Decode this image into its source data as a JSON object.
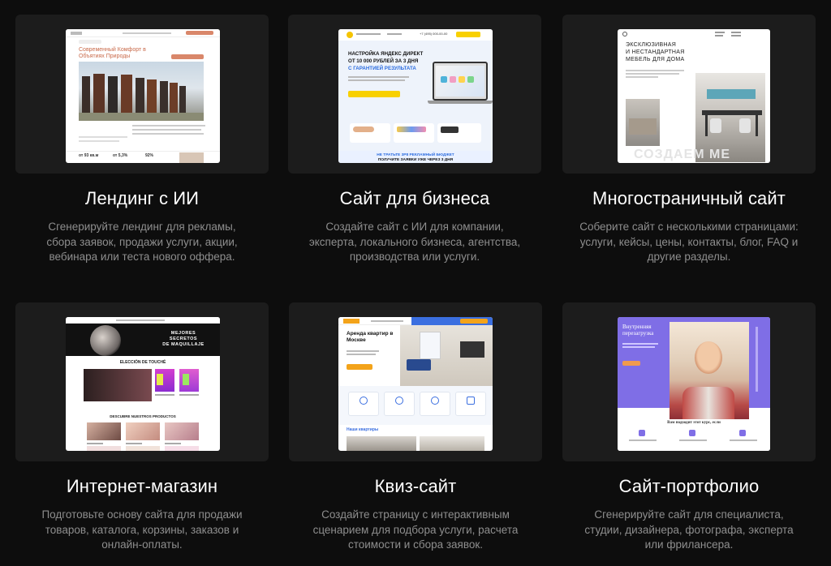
{
  "cards": [
    {
      "title": "Лендинг с ИИ",
      "description": "Сгенерируйте лендинг для рекламы,\nсбора заявок, продажи услуги, акции,\nвебинара или теста нового оффера.",
      "preview": {
        "headline": "Современный Комфорт в Объятиях Природы",
        "stats": [
          "от 93 кв.м",
          "от 5,3%",
          "92%"
        ]
      }
    },
    {
      "title": "Сайт для бизнеса",
      "description": "Создайте сайт с ИИ для компании,\nэксперта, локального бизнеса, агентства,\nпроизводства или услуги.",
      "preview": {
        "phone": "+7 (495) 000-00-00",
        "headline_1": "НАСТРОЙКА ЯНДЕКС ДИРЕКТ",
        "headline_2": "ОТ 10 000 РУБЛЕЙ ЗА 3 ДНЯ",
        "headline_3": "С ГАРАНТИЕЙ РЕЗУЛЬТАТА",
        "footer_1": "НЕ ТРАТЬТЕ 3Р8 РЕКЛАМНЫЙ БЮДЖЕТ",
        "footer_2": "ПОЛУЧИТЕ ЗАЯВКИ УЖЕ ЧЕРЕЗ 3 ДНЯ"
      }
    },
    {
      "title": "Многостраничный сайт",
      "description": "Соберите сайт с несколькими страницами:\nуслуги, кейсы, цены, контакты, блог, FAQ и\nдругие разделы.",
      "preview": {
        "headline_1": "ЭКСКЛЮЗИВНАЯ",
        "headline_2": "И НЕСТАНДАРТНАЯ",
        "headline_3": "МЕБЕЛЬ ДЛЯ ДОМА",
        "watermark": "СОЗДАЕМ МЕ"
      }
    },
    {
      "title": "Интернет-магазин",
      "description": "Подготовьте основу сайта для продажи\nтоваров, каталога, корзины, заказов и\nонлайн-оплаты.",
      "preview": {
        "hero_1": "MEJORES",
        "hero_2": "SECRETOS",
        "hero_3": "DE MAQUILLAJE",
        "section_1": "ELECCIÓN DE TOUCHÉ",
        "section_2": "DESCUBRE NUESTROS PRODUCTOS"
      }
    },
    {
      "title": "Квиз-сайт",
      "description": "Создайте страницу с интерактивным\nсценарием для подбора услуги, расчета\nстоимости и сбора заявок.",
      "preview": {
        "headline": "Аренда квартир в Москве",
        "section": "Наши квартиры"
      }
    },
    {
      "title": "Сайт-портфолио",
      "description": "Сгенерируйте сайт для специалиста,\nстудии, дизайнера, фотографа, эксперта\nили фрилансера.",
      "preview": {
        "headline": "Внутренняя перезагрузка",
        "subhead": "Вам подходит этот курс, если"
      }
    }
  ],
  "colors": {
    "background": "#0d0d0d",
    "card": "#1c1c1c",
    "title": "#ffffff",
    "description": "#8e8e8e"
  }
}
